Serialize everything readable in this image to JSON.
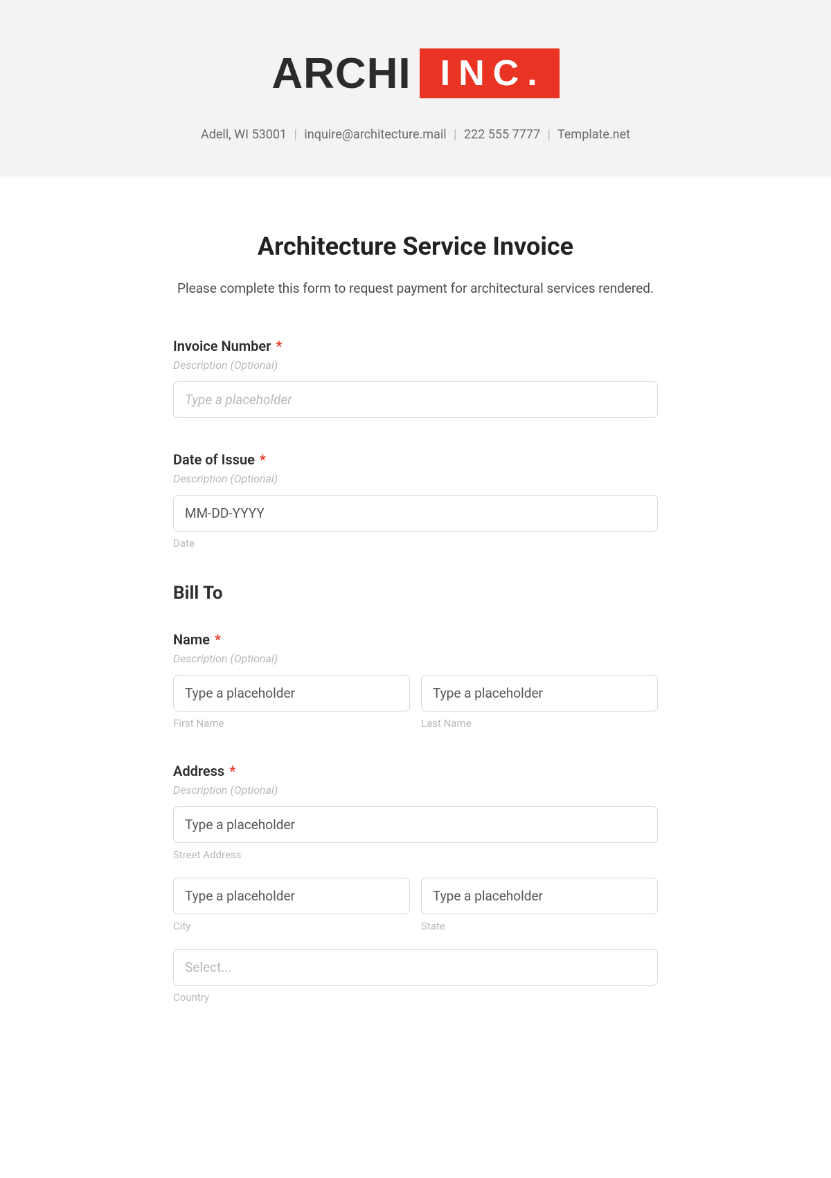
{
  "header": {
    "logo_main": "ARCHI",
    "logo_badge": "INC.",
    "contact": {
      "address": "Adell, WI 53001",
      "email": "inquire@architecture.mail",
      "phone": "222 555 7777",
      "site": "Template.net"
    }
  },
  "form": {
    "title": "Architecture Service Invoice",
    "intro": "Please complete this form to request payment for architectural services rendered.",
    "desc_optional": "Description (Optional)",
    "invoice_number": {
      "label": "Invoice Number",
      "placeholder": "Type a placeholder"
    },
    "date_of_issue": {
      "label": "Date of Issue",
      "placeholder": "MM-DD-YYYY",
      "sublabel": "Date"
    },
    "bill_to_heading": "Bill To",
    "name": {
      "label": "Name",
      "first_placeholder": "Type a placeholder",
      "last_placeholder": "Type a placeholder",
      "first_sublabel": "First Name",
      "last_sublabel": "Last Name"
    },
    "address": {
      "label": "Address",
      "street_placeholder": "Type a placeholder",
      "street_sublabel": "Street Address",
      "city_placeholder": "Type a placeholder",
      "city_sublabel": "City",
      "state_placeholder": "Type a placeholder",
      "state_sublabel": "State",
      "country_placeholder": "Select...",
      "country_sublabel": "Country"
    }
  }
}
